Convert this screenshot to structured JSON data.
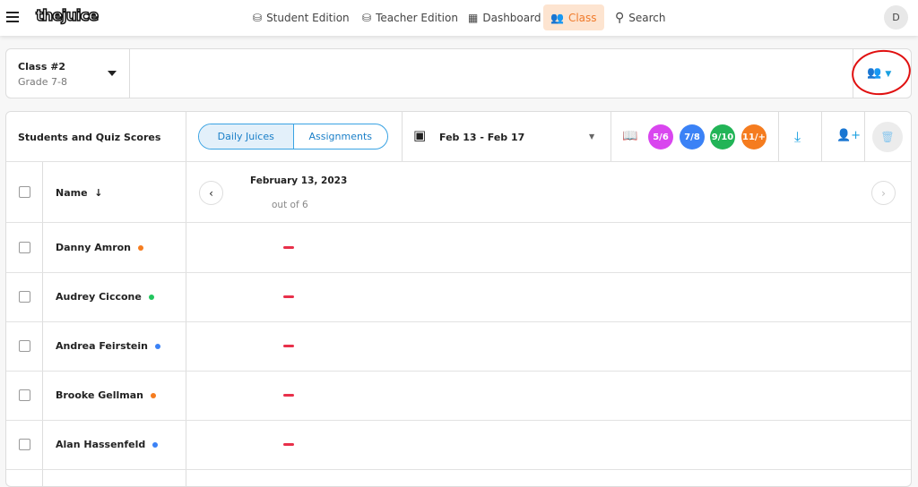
{
  "nav": {
    "logo": "thejuice",
    "items": [
      {
        "label": "Student Edition",
        "icon": "cup-icon"
      },
      {
        "label": "Teacher Edition",
        "icon": "cup-icon"
      },
      {
        "label": "Dashboard",
        "icon": "grid-icon"
      },
      {
        "label": "Class",
        "icon": "users-icon",
        "active": true
      },
      {
        "label": "Search",
        "icon": "search-icon"
      }
    ],
    "avatar": "D"
  },
  "class_selector": {
    "name": "Class #2",
    "grade": "Grade 7-8"
  },
  "table": {
    "title": "Students and Quiz Scores",
    "tabs": [
      "Daily Juices",
      "Assignments"
    ],
    "date_range": "Feb 13 - Feb 17",
    "levels": [
      {
        "label": "5/6",
        "color": "#d946ef"
      },
      {
        "label": "7/8",
        "color": "#3b82f6"
      },
      {
        "label": "9/10",
        "color": "#22b457"
      },
      {
        "label": "11/+",
        "color": "#f57c1f"
      }
    ],
    "name_header": "Name",
    "day": "February 13, 2023",
    "out_of": "out of 6",
    "rows": [
      {
        "name": "Danny Amron",
        "dot": "#f57c1f",
        "score": "–"
      },
      {
        "name": "Audrey Ciccone",
        "dot": "#22c55e",
        "score": "–"
      },
      {
        "name": "Andrea Feirstein",
        "dot": "#3b82f6",
        "score": "–"
      },
      {
        "name": "Brooke Gellman",
        "dot": "#f57c1f",
        "score": "–"
      },
      {
        "name": "Alan Hassenfeld",
        "dot": "#3b82f6",
        "score": "–"
      }
    ]
  }
}
